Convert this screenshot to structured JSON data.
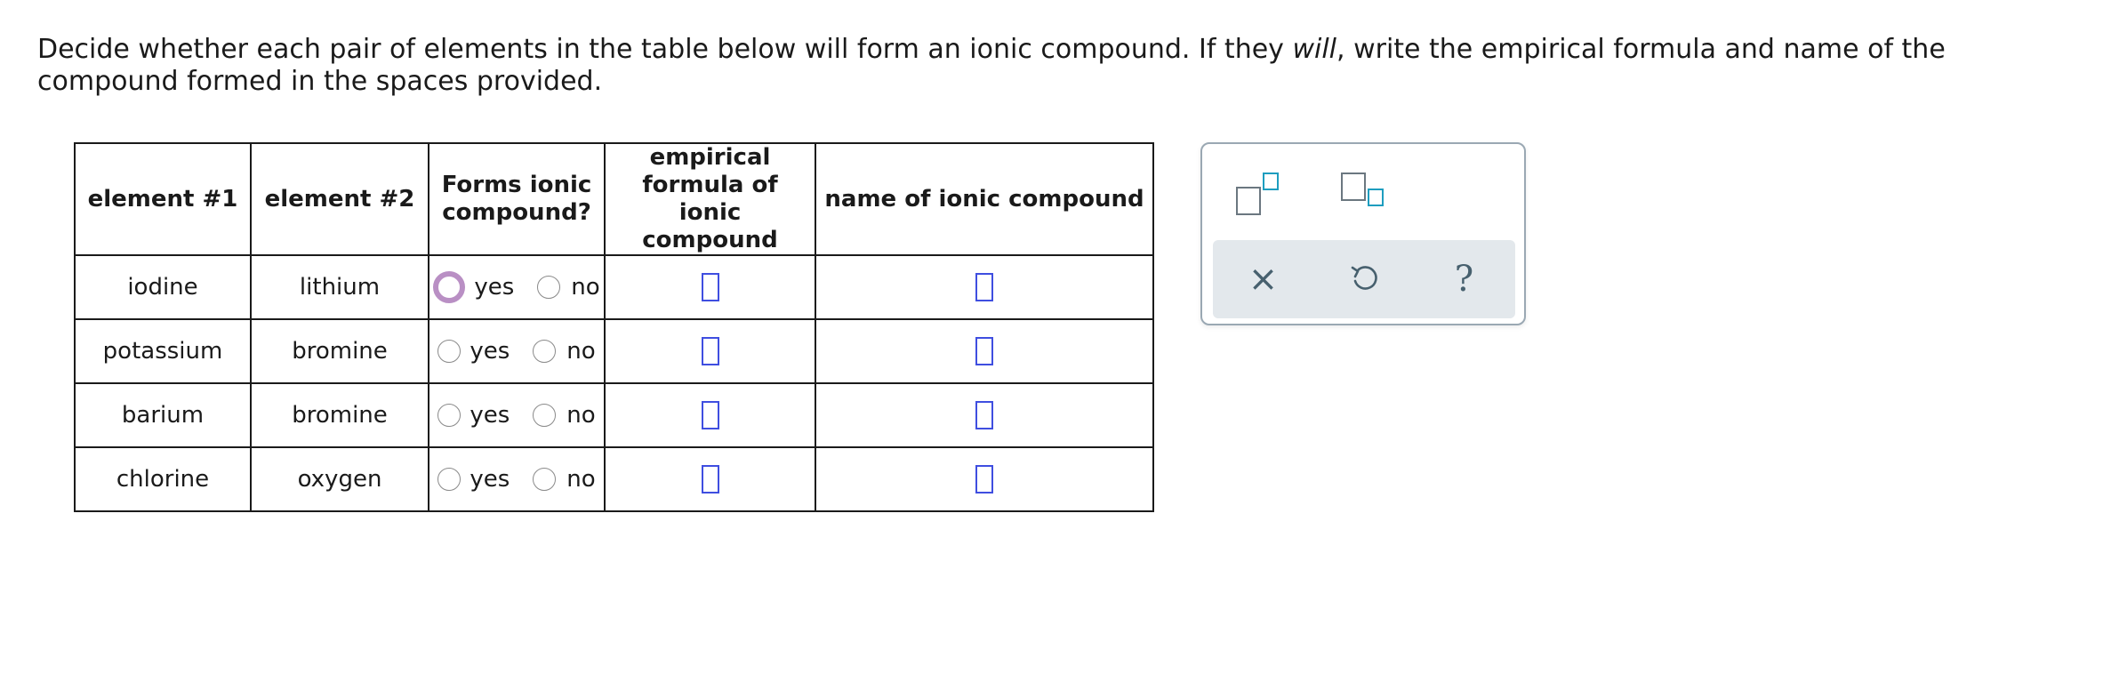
{
  "prompt": {
    "before": "Decide whether each pair of elements in the table below will form an ionic compound. If they ",
    "emphasis": "will",
    "after": ", write the empirical formula and name of the compound formed in the spaces provided."
  },
  "table": {
    "headers": {
      "element1": "element #1",
      "element2": "element #2",
      "forms": "Forms ionic compound?",
      "formula": "empirical formula of ionic compound",
      "name": "name of ionic compound"
    },
    "option_yes": "yes",
    "option_no": "no",
    "rows": [
      {
        "element1": "iodine",
        "element2": "lithium",
        "focused": "yes"
      },
      {
        "element1": "potassium",
        "element2": "bromine",
        "focused": ""
      },
      {
        "element1": "barium",
        "element2": "bromine",
        "focused": ""
      },
      {
        "element1": "chlorine",
        "element2": "oxygen",
        "focused": ""
      }
    ]
  },
  "palette": {
    "tools": [
      "superscript-tool-icon",
      "subscript-tool-icon"
    ],
    "actions": [
      "clear-icon",
      "undo-icon",
      "help-icon"
    ],
    "glyphs": {
      "clear": "×",
      "help": "?"
    },
    "colors": {
      "accent": "#1e9dbf",
      "answer_box": "#3f4ee0",
      "focus_ring": "#b98fc4",
      "bar": "#e3e8ec"
    }
  }
}
